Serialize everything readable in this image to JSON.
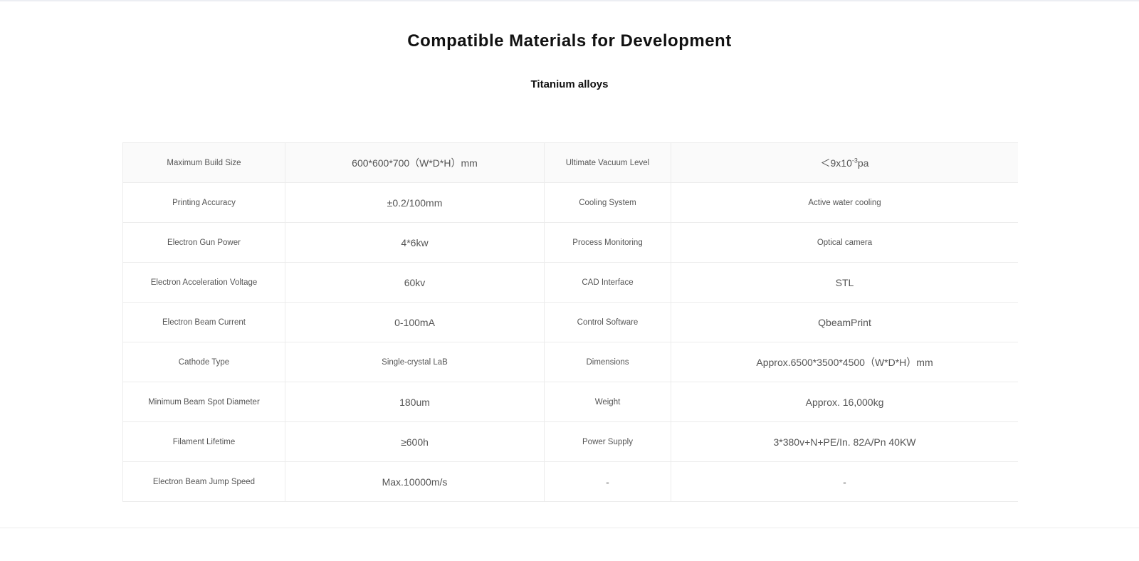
{
  "heading": "Compatible Materials for Development",
  "subheading": "Titanium alloys",
  "specs": {
    "rows": [
      {
        "label1": "Maximum Build Size",
        "value1": "600*600*700（W*D*H）mm",
        "label2": "Ultimate Vacuum Level",
        "value2_base": "＜9x10",
        "value2_exp": "-3",
        "value2_unit": "pa"
      },
      {
        "label1": "Printing Accuracy",
        "value1": "±0.2/100mm",
        "label2": "Cooling System",
        "value2": "Active water cooling"
      },
      {
        "label1": "Electron Gun Power",
        "value1": "4*6kw",
        "label2": "Process Monitoring",
        "value2": "Optical camera"
      },
      {
        "label1": "Electron Acceleration Voltage",
        "value1": "60kv",
        "label2": "CAD Interface",
        "value2": "STL"
      },
      {
        "label1": "Electron Beam Current",
        "value1": "0-100mA",
        "label2": "Control Software",
        "value2": "QbeamPrint"
      },
      {
        "label1": "Cathode Type",
        "value1": "Single-crystal LaB",
        "label2": "Dimensions",
        "value2": "Approx.6500*3500*4500（W*D*H）mm"
      },
      {
        "label1": "Minimum Beam Spot Diameter",
        "value1": "180um",
        "label2": "Weight",
        "value2": "Approx. 16,000kg"
      },
      {
        "label1": "Filament Lifetime",
        "value1": "≥600h",
        "label2": "Power Supply",
        "value2": "3*380v+N+PE/In. 82A/Pn 40KW"
      },
      {
        "label1": "Electron Beam Jump Speed",
        "value1": "Max.10000m/s",
        "label2": "-",
        "value2": "-"
      }
    ]
  }
}
